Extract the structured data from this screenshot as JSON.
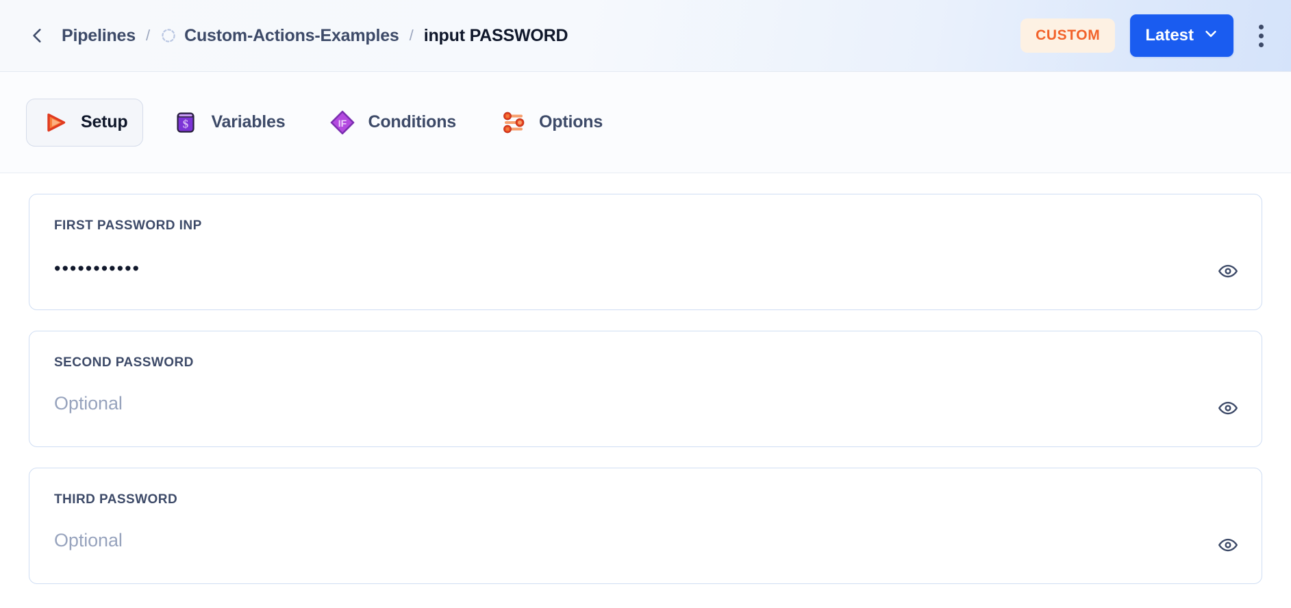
{
  "header": {
    "back_icon": "chevron-left-icon",
    "breadcrumb": {
      "root_label": "Pipelines",
      "separator": "/",
      "project_icon": "dashed-circle-icon",
      "project_label": "Custom-Actions-Examples",
      "current_label": "input PASSWORD"
    },
    "badge_label": "CUSTOM",
    "version_button": {
      "label": "Latest",
      "chevron_icon": "chevron-down-icon"
    },
    "overflow_icon": "kebab-menu-icon",
    "colors": {
      "badge_bg": "#fdf1e3",
      "badge_text": "#f2622a",
      "primary_button": "#1a5cf0"
    }
  },
  "tabs": [
    {
      "id": "setup",
      "label": "Setup",
      "icon": "play-triangle-icon",
      "active": true
    },
    {
      "id": "variables",
      "label": "Variables",
      "icon": "dollar-variable-icon",
      "active": false
    },
    {
      "id": "conditions",
      "label": "Conditions",
      "icon": "if-diamond-icon",
      "active": false
    },
    {
      "id": "options",
      "label": "Options",
      "icon": "sliders-icon",
      "active": false
    }
  ],
  "fields": [
    {
      "id": "first-password",
      "label": "FIRST PASSWORD INP",
      "value": "•••••••••••",
      "placeholder": "",
      "masked": true,
      "toggle_icon": "eye-icon"
    },
    {
      "id": "second-password",
      "label": "SECOND PASSWORD",
      "value": "",
      "placeholder": "Optional",
      "masked": true,
      "toggle_icon": "eye-icon"
    },
    {
      "id": "third-password",
      "label": "THIRD PASSWORD",
      "value": "",
      "placeholder": "Optional",
      "masked": true,
      "toggle_icon": "eye-icon"
    }
  ]
}
